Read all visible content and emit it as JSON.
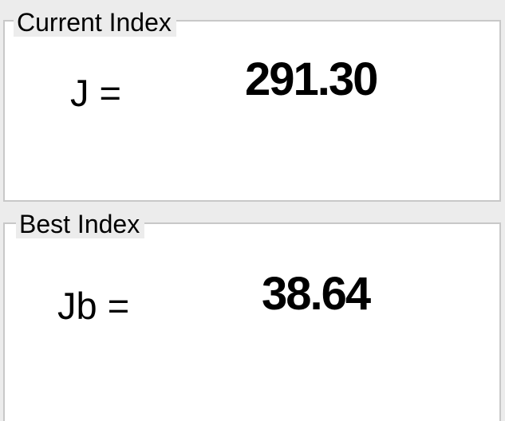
{
  "current_index": {
    "title": "Current Index",
    "label": "J =",
    "value": "291.30"
  },
  "best_index": {
    "title": "Best Index",
    "label": "Jb =",
    "value": "38.64"
  }
}
